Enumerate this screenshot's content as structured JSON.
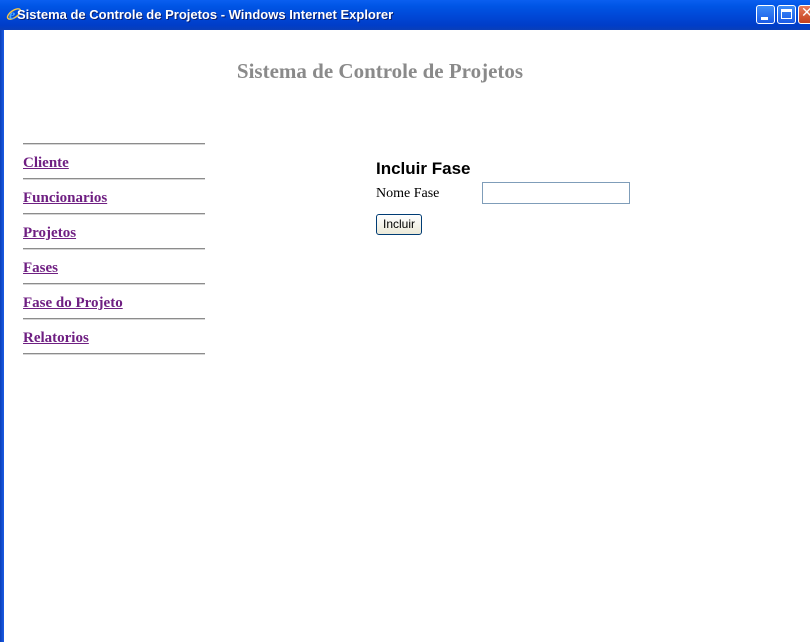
{
  "window": {
    "title": "Sistema de Controle de Projetos - Windows Internet Explorer",
    "app_icon": "ie-logo-icon",
    "controls": [
      "minimize",
      "maximize",
      "close"
    ]
  },
  "page": {
    "title": "Sistema de Controle de Projetos"
  },
  "nav": {
    "items": [
      {
        "label": "Cliente"
      },
      {
        "label": "Funcionarios"
      },
      {
        "label": "Projetos"
      },
      {
        "label": "Fases"
      },
      {
        "label": "Fase do Projeto"
      },
      {
        "label": "Relatorios"
      }
    ]
  },
  "form": {
    "heading": "Incluir Fase",
    "name_label": "Nome Fase",
    "name_value": "",
    "submit_label": "Incluir"
  },
  "colors": {
    "titlebar": "#0055e5",
    "page_title": "#8a8a8a",
    "link": "#6f1f82"
  }
}
